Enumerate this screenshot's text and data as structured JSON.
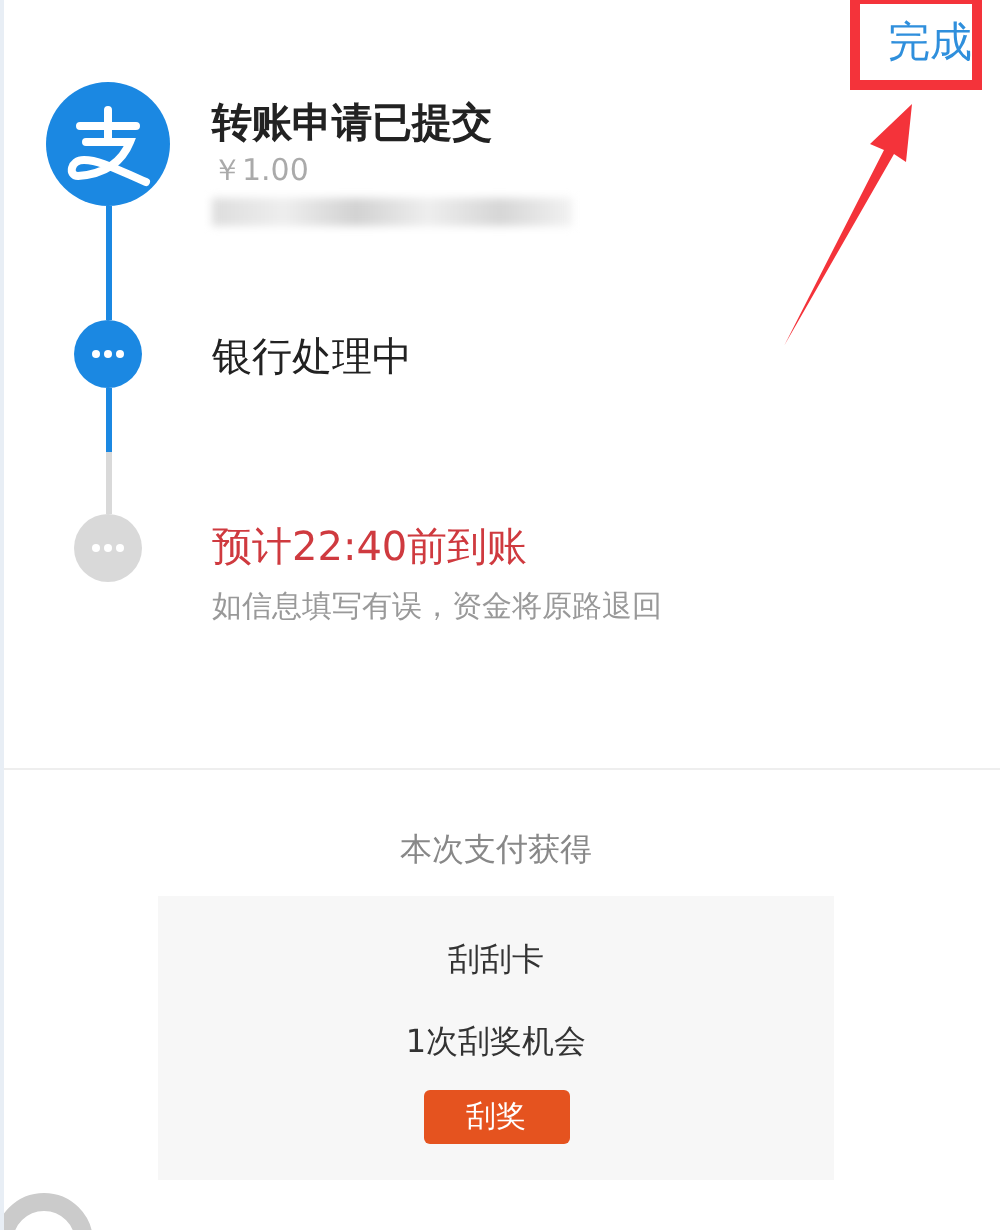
{
  "header": {
    "done_link": "完成"
  },
  "steps": [
    {
      "kind": "logo",
      "done": true,
      "title": "转账申请已提交",
      "amount": "￥1.00",
      "redacted": true
    },
    {
      "kind": "dots",
      "done": true,
      "title": "银行处理中"
    },
    {
      "kind": "dots",
      "done": false,
      "title": "预计22:40前到账",
      "note": "如信息填写有误，资金将原路退回"
    }
  ],
  "reward": {
    "heading": "本次支付获得",
    "card_title": "刮刮卡",
    "card_text": "1次刮奖机会",
    "button": "刮奖"
  }
}
